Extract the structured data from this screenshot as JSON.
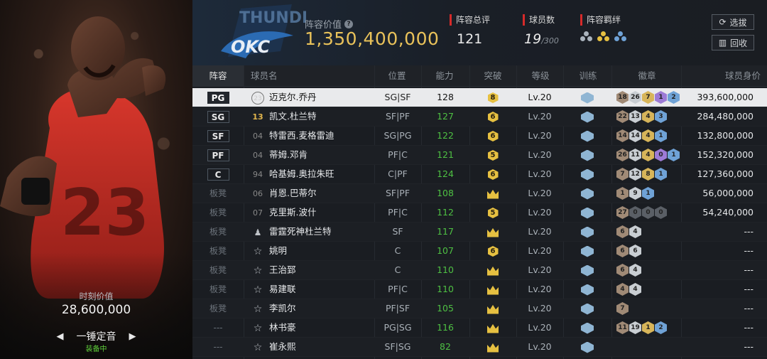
{
  "card": {
    "market_value_label": "时刻价值",
    "market_value": "28,600,000",
    "name": "一锤定音",
    "equip_status": "装备中",
    "prev_icon": "left-triangle-icon",
    "next_icon": "right-triangle-icon"
  },
  "header": {
    "lineup_value_label": "阵容价值",
    "lineup_value": "1,350,400,000",
    "rating_label": "阵容总评",
    "rating": "121",
    "count_label": "球员数",
    "count": "19",
    "count_max": "/300",
    "bond_label": "阵容羁绊",
    "select_button": "选拔",
    "recycle_button": "回收",
    "logo_text": "OKC"
  },
  "columns": {
    "lineup": "阵容",
    "name": "球员名",
    "position": "位置",
    "ability": "能力",
    "breakthrough": "突破",
    "level": "等级",
    "training": "训练",
    "badges": "徽章",
    "value": "球员身价"
  },
  "rows": [
    {
      "slot": "PG",
      "slot_type": "badge",
      "jersey": "23",
      "jersey_style": "circ",
      "name": "迈克尔.乔丹",
      "pos": "SG|SF",
      "ability": "128",
      "brk": "8",
      "brk_style": "num",
      "level": "Lv.20",
      "badges": [
        {
          "t": "18",
          "c": "br"
        },
        {
          "t": "26",
          "c": "si"
        },
        {
          "t": "7",
          "c": "go"
        },
        {
          "t": "1",
          "c": "pu"
        },
        {
          "t": "2",
          "c": "bl"
        }
      ],
      "value": "393,600,000",
      "selected": true
    },
    {
      "slot": "SG",
      "slot_type": "badge",
      "jersey": "13",
      "jersey_style": "gold",
      "name": "凯文.杜兰特",
      "pos": "SF|PF",
      "ability": "127",
      "brk": "6",
      "brk_style": "num",
      "level": "Lv.20",
      "badges": [
        {
          "t": "22",
          "c": "br"
        },
        {
          "t": "13",
          "c": "si"
        },
        {
          "t": "4",
          "c": "go"
        },
        {
          "t": "3",
          "c": "bl"
        }
      ],
      "value": "284,480,000"
    },
    {
      "slot": "SF",
      "slot_type": "badge",
      "jersey": "04",
      "jersey_style": "plain",
      "name": "特雷西.麦格雷迪",
      "pos": "SG|PG",
      "ability": "122",
      "brk": "6",
      "brk_style": "num",
      "level": "Lv.20",
      "badges": [
        {
          "t": "14",
          "c": "br"
        },
        {
          "t": "14",
          "c": "si"
        },
        {
          "t": "4",
          "c": "go"
        },
        {
          "t": "1",
          "c": "bl"
        }
      ],
      "value": "132,800,000"
    },
    {
      "slot": "PF",
      "slot_type": "badge",
      "jersey": "04",
      "jersey_style": "plain",
      "name": "蒂姆.邓肯",
      "pos": "PF|C",
      "ability": "121",
      "brk": "5",
      "brk_style": "num",
      "level": "Lv.20",
      "badges": [
        {
          "t": "26",
          "c": "br"
        },
        {
          "t": "11",
          "c": "si"
        },
        {
          "t": "4",
          "c": "go"
        },
        {
          "t": "0",
          "c": "pu"
        },
        {
          "t": "1",
          "c": "bl"
        }
      ],
      "value": "152,320,000"
    },
    {
      "slot": "C",
      "slot_type": "badge",
      "jersey": "94",
      "jersey_style": "plain",
      "name": "哈基姆.奥拉朱旺",
      "pos": "C|PF",
      "ability": "124",
      "brk": "6",
      "brk_style": "num",
      "level": "Lv.20",
      "badges": [
        {
          "t": "7",
          "c": "br"
        },
        {
          "t": "12",
          "c": "si"
        },
        {
          "t": "8",
          "c": "go"
        },
        {
          "t": "1",
          "c": "bl"
        }
      ],
      "value": "127,360,000"
    },
    {
      "slot": "板凳",
      "slot_type": "text",
      "jersey": "06",
      "jersey_style": "plain",
      "name": "肖恩.巴蒂尔",
      "pos": "SF|PF",
      "ability": "108",
      "brk": "",
      "brk_style": "crown",
      "level": "Lv.20",
      "badges": [
        {
          "t": "1",
          "c": "br"
        },
        {
          "t": "9",
          "c": "si"
        },
        {
          "t": "1",
          "c": "bl"
        }
      ],
      "value": "56,000,000"
    },
    {
      "slot": "板凳",
      "slot_type": "text",
      "jersey": "07",
      "jersey_style": "plain",
      "name": "克里斯.波什",
      "pos": "PF|C",
      "ability": "112",
      "brk": "5",
      "brk_style": "num",
      "level": "Lv.20",
      "badges": [
        {
          "t": "27",
          "c": "br"
        },
        {
          "t": "0",
          "c": "dk"
        },
        {
          "t": "0",
          "c": "dk"
        },
        {
          "t": "0",
          "c": "dk"
        }
      ],
      "value": "54,240,000"
    },
    {
      "slot": "板凳",
      "slot_type": "text",
      "jersey": "",
      "jersey_style": "person",
      "name": "雷霆死神杜兰特",
      "pos": "SF",
      "ability": "117",
      "brk": "",
      "brk_style": "crown",
      "level": "Lv.20",
      "badges": [
        {
          "t": "6",
          "c": "br"
        },
        {
          "t": "4",
          "c": "si"
        }
      ],
      "value": "---"
    },
    {
      "slot": "板凳",
      "slot_type": "text",
      "jersey": "",
      "jersey_style": "star",
      "name": "姚明",
      "pos": "C",
      "ability": "107",
      "brk": "6",
      "brk_style": "num",
      "level": "Lv.20",
      "badges": [
        {
          "t": "6",
          "c": "br"
        },
        {
          "t": "6",
          "c": "si"
        }
      ],
      "value": "---"
    },
    {
      "slot": "板凳",
      "slot_type": "text",
      "jersey": "",
      "jersey_style": "star",
      "name": "王治郅",
      "pos": "C",
      "ability": "110",
      "brk": "",
      "brk_style": "crown",
      "level": "Lv.20",
      "badges": [
        {
          "t": "6",
          "c": "br"
        },
        {
          "t": "4",
          "c": "si"
        }
      ],
      "value": "---"
    },
    {
      "slot": "板凳",
      "slot_type": "text",
      "jersey": "",
      "jersey_style": "star",
      "name": "易建联",
      "pos": "PF|C",
      "ability": "110",
      "brk": "",
      "brk_style": "crown",
      "level": "Lv.20",
      "badges": [
        {
          "t": "4",
          "c": "br"
        },
        {
          "t": "4",
          "c": "si"
        }
      ],
      "value": "---"
    },
    {
      "slot": "板凳",
      "slot_type": "text",
      "jersey": "",
      "jersey_style": "star",
      "name": "李凯尔",
      "pos": "PF|SF",
      "ability": "105",
      "brk": "",
      "brk_style": "crown",
      "level": "Lv.20",
      "badges": [
        {
          "t": "7",
          "c": "br"
        }
      ],
      "value": "---"
    },
    {
      "slot": "---",
      "slot_type": "text",
      "jersey": "",
      "jersey_style": "star",
      "name": "林书豪",
      "pos": "PG|SG",
      "ability": "116",
      "brk": "",
      "brk_style": "crown",
      "level": "Lv.20",
      "badges": [
        {
          "t": "11",
          "c": "br"
        },
        {
          "t": "19",
          "c": "si"
        },
        {
          "t": "1",
          "c": "go"
        },
        {
          "t": "2",
          "c": "bl"
        }
      ],
      "value": "---"
    },
    {
      "slot": "---",
      "slot_type": "text",
      "jersey": "",
      "jersey_style": "star",
      "name": "崔永熙",
      "pos": "SF|SG",
      "ability": "82",
      "brk": "",
      "brk_style": "crown",
      "level": "Lv.20",
      "badges": [],
      "value": "---"
    }
  ],
  "colors": {
    "accent_gold": "#e9c25a",
    "ability_green": "#4ec043",
    "equip_green": "#5fcf3a",
    "label_red": "#d62a2a"
  }
}
